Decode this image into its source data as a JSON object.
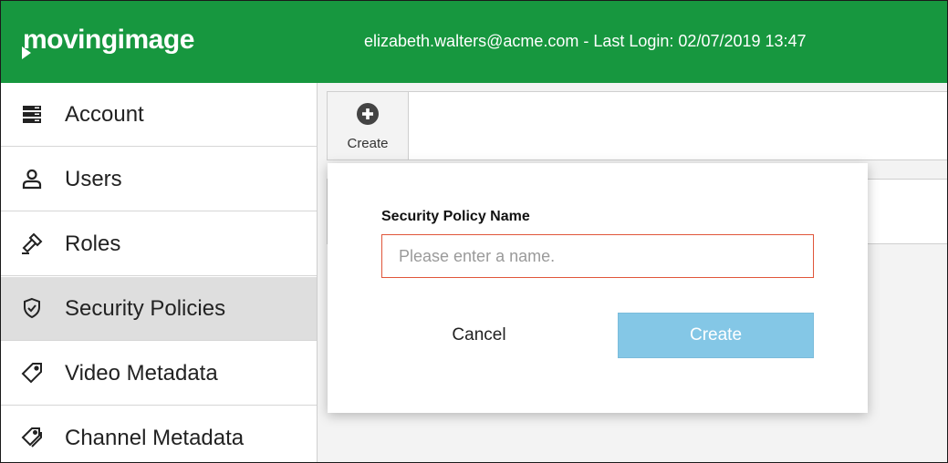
{
  "header": {
    "logo": "movingimage",
    "user_email": "elizabeth.walters@acme.com",
    "last_login": "Last Login: 02/07/2019 13:47",
    "user_info": "elizabeth.walters@acme.com - Last Login: 02/07/2019 13:47"
  },
  "sidebar": {
    "items": [
      {
        "label": "Account",
        "icon": "server-icon"
      },
      {
        "label": "Users",
        "icon": "user-icon"
      },
      {
        "label": "Roles",
        "icon": "gavel-icon"
      },
      {
        "label": "Security Policies",
        "icon": "shield-icon",
        "active": true
      },
      {
        "label": "Video Metadata",
        "icon": "tag-icon"
      },
      {
        "label": "Channel Metadata",
        "icon": "tags-icon"
      }
    ]
  },
  "toolbar": {
    "create_label": "Create"
  },
  "dialog": {
    "field_label": "Security Policy Name",
    "input_value": "",
    "input_placeholder": "Please enter a name.",
    "cancel_label": "Cancel",
    "create_label": "Create"
  },
  "colors": {
    "header_green": "#17973f",
    "create_button_blue": "#84c7e6",
    "input_error_border": "#e0553a",
    "active_nav_bg": "#dedede"
  }
}
